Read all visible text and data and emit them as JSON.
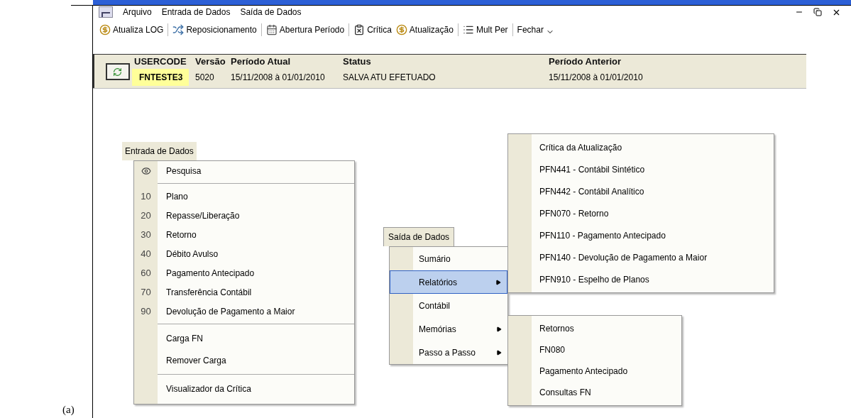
{
  "caption": "(a)",
  "menu_bar": {
    "items": [
      "Arquivo",
      "Entrada de Dados",
      "Saída de Dados"
    ]
  },
  "toolbar": {
    "items": [
      {
        "label": "Atualiza LOG",
        "separator_after": true
      },
      {
        "label": "Reposicionamento",
        "separator_after": true
      },
      {
        "label": "Abertura Período",
        "separator_after": true
      },
      {
        "label": "Crítica",
        "separator_after": false
      },
      {
        "label": "Atualização",
        "separator_after": true
      },
      {
        "label": "Mult Per",
        "separator_after": true
      },
      {
        "label": "Fechar",
        "separator_after": false
      }
    ]
  },
  "info_panel": {
    "columns": [
      {
        "header": "USERCODE",
        "value": "FNTESTE3",
        "highlighted": true
      },
      {
        "header": "Versão",
        "value": "5020",
        "highlighted": false
      },
      {
        "header": "Período Atual",
        "value": "15/11/2008 à 01/01/2010",
        "highlighted": false
      },
      {
        "header": "Status",
        "value": "SALVA ATU EFETUADO",
        "highlighted": false
      },
      {
        "header": "Período Anterior",
        "value": "15/11/2008 à 01/01/2010",
        "highlighted": false
      }
    ]
  },
  "entry_menu": {
    "title": "Entrada de Dados",
    "items": [
      {
        "kind": "icon",
        "label": "Pesquisa",
        "separator_before": false
      },
      {
        "kind": "numbered",
        "code": "10",
        "label": "Plano",
        "separator_before": true
      },
      {
        "kind": "numbered",
        "code": "20",
        "label": "Repasse/Liberação",
        "separator_before": false
      },
      {
        "kind": "numbered",
        "code": "30",
        "label": "Retorno",
        "separator_before": false
      },
      {
        "kind": "numbered",
        "code": "40",
        "label": "Débito Avulso",
        "separator_before": false
      },
      {
        "kind": "numbered",
        "code": "60",
        "label": "Pagamento Antecipado",
        "separator_before": false
      },
      {
        "kind": "numbered",
        "code": "70",
        "label": "Transferência Contábil",
        "separator_before": false
      },
      {
        "kind": "numbered",
        "code": "90",
        "label": "Devolução de Pagamento a Maior",
        "separator_before": false
      },
      {
        "kind": "plain",
        "label": "Carga FN",
        "separator_before": true
      },
      {
        "kind": "plain",
        "label": "Remover Carga",
        "separator_before": false
      },
      {
        "kind": "plain",
        "label": "Visualizador da Crítica",
        "separator_before": true
      }
    ]
  },
  "output_menu": {
    "title": "Saída de Dados",
    "items": [
      {
        "label": "Sumário",
        "submenu": false,
        "selected": false
      },
      {
        "label": "Relatórios",
        "submenu": true,
        "selected": true
      },
      {
        "label": "Contábil",
        "submenu": false,
        "selected": false
      },
      {
        "label": "Memórias",
        "submenu": true,
        "selected": false
      },
      {
        "label": "Passo a Passo",
        "submenu": true,
        "selected": false
      }
    ]
  },
  "reports_submenu": {
    "items": [
      "Crítica da Atualização",
      "PFN441 - Contábil Sintético",
      "PFN442 - Contábil Analítico",
      "PFN070 - Retorno",
      "PFN110 - Pagamento Antecipado",
      "PFN140 - Devolução de Pagamento a Maior",
      "PFN910 - Espelho de Planos"
    ]
  },
  "memories_submenu": {
    "items": [
      "Retornos",
      "FN080",
      "Pagamento Antecipado",
      "Consultas FN"
    ]
  }
}
